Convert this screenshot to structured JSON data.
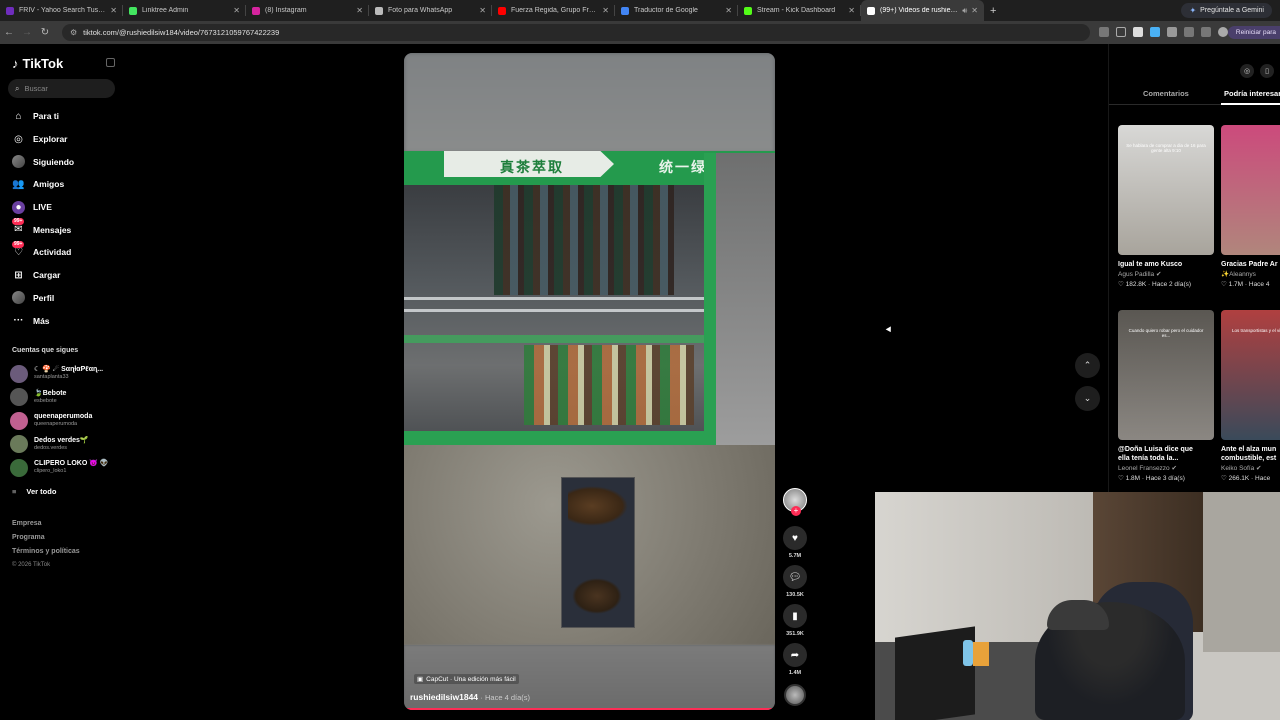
{
  "browser": {
    "tabs": [
      {
        "label": "FRIV - Yahoo Search Tus resultad",
        "color": "#6f2dbd"
      },
      {
        "label": "Linktree Admin",
        "color": "#43e660"
      },
      {
        "label": "(8) Instagram",
        "color": "#d6249f"
      },
      {
        "label": "Foto para WhatsApp",
        "color": "#bbbbbb"
      },
      {
        "label": "Fuerza Regida, Grupo Frontera",
        "color": "#ff0000"
      },
      {
        "label": "Traductor de Google",
        "color": "#4285f4"
      },
      {
        "label": "Stream - Kick Dashboard",
        "color": "#53fc18"
      },
      {
        "label": "(99+) Videos de rushiedilsiw",
        "color": "#ffffff"
      }
    ],
    "new_tab": "+",
    "gemini_label": "Pregúntale a Gemini",
    "url": "tiktok.com/@rushiedilsiw184/video/7673121059767422239",
    "reiniciar_label": "Reiniciar para"
  },
  "sidebar": {
    "logo": "TikTok",
    "search_placeholder": "Buscar",
    "nav": [
      {
        "label": "Para ti",
        "icon": "home-icon",
        "glyph": "⌂"
      },
      {
        "label": "Explorar",
        "icon": "compass-icon",
        "glyph": "◎"
      },
      {
        "label": "Siguiendo",
        "icon": "avatar-icon",
        "glyph": ""
      },
      {
        "label": "Amigos",
        "icon": "friends-icon",
        "glyph": "👥"
      },
      {
        "label": "LIVE",
        "icon": "live-icon",
        "glyph": "●"
      },
      {
        "label": "Mensajes",
        "icon": "messages-icon",
        "glyph": "✉",
        "badge": "99+"
      },
      {
        "label": "Actividad",
        "icon": "activity-icon",
        "glyph": "♡",
        "badge": "99+"
      },
      {
        "label": "Cargar",
        "icon": "upload-icon",
        "glyph": "⊞"
      },
      {
        "label": "Perfil",
        "icon": "profile-icon",
        "glyph": ""
      },
      {
        "label": "Más",
        "icon": "more-icon",
        "glyph": "···"
      }
    ],
    "following_title": "Cuentas que sigues",
    "following": [
      {
        "name": "☾ 🍄 ☄ SαɳƚαPℓαɳ...",
        "user": "santaplanta33",
        "color": "#6b5b7b"
      },
      {
        "name": "🍃Bebote",
        "user": "esbebote",
        "color": "#555"
      },
      {
        "name": "queenaperumoda",
        "user": "queenaperumoda",
        "color": "#c06090"
      },
      {
        "name": "Dedos verdes🌱",
        "user": "dedos.verdes",
        "color": "#6a7a5a"
      },
      {
        "name": "CLIPERO LOKO 👿 👽",
        "user": "clipero_loko1",
        "color": "#3a6a3a"
      }
    ],
    "see_all": "Ver todo",
    "footer": [
      "Empresa",
      "Programa",
      "Términos y políticas"
    ],
    "copyright": "© 2026 TikTok"
  },
  "video": {
    "sign_left": "真茶萃取",
    "sign_right": "统一绿茶",
    "capcut": "CapCut · Una edición más fácil",
    "author": "rushiedilsiw1844",
    "date": "· Hace 4 día(s)",
    "progress": 1.0
  },
  "actions": {
    "likes": "5.7M",
    "comments": "130.5K",
    "saves": "351.9K",
    "shares": "1.4M"
  },
  "right_panel": {
    "tabs": [
      "Comentarios",
      "Podría interesarte"
    ],
    "cards": [
      {
        "title": "Igual te amo Kusco",
        "author": "Agus Padilla ✔",
        "likes": "182.8K",
        "time": "Hace 2 día(s)",
        "caption": "Se hablara de comprar a dia de 16 para gente alta 9:10",
        "bg": "linear-gradient(180deg,#d8d8d6,#a8a49c)"
      },
      {
        "title": "Gracias Padre Ar",
        "author": "✨Aleannys",
        "likes": "1.7M",
        "time": "Hace 4",
        "caption": "",
        "bg": "linear-gradient(180deg,#cc4a7c,#b0867c)"
      },
      {
        "title": "@Doña Luisa dice que",
        "title2": "ella tenía toda la...",
        "author": "Leonel Fransezzo ✔",
        "likes": "1.8M",
        "time": "Hace 3 día(s)",
        "caption": "Cuando quiero robar pero el cuidador es...",
        "bg": "linear-gradient(180deg,#5a5752,#8b8782)"
      },
      {
        "title": "Ante el alza mun",
        "title2": "combustible, est",
        "author": "Keiko Sofía ✔",
        "likes": "266.1K",
        "time": "Hace",
        "caption": "Los transportistas y el vicepresidente",
        "bg": "linear-gradient(180deg,#b04040,#3a4a5a)"
      }
    ]
  }
}
